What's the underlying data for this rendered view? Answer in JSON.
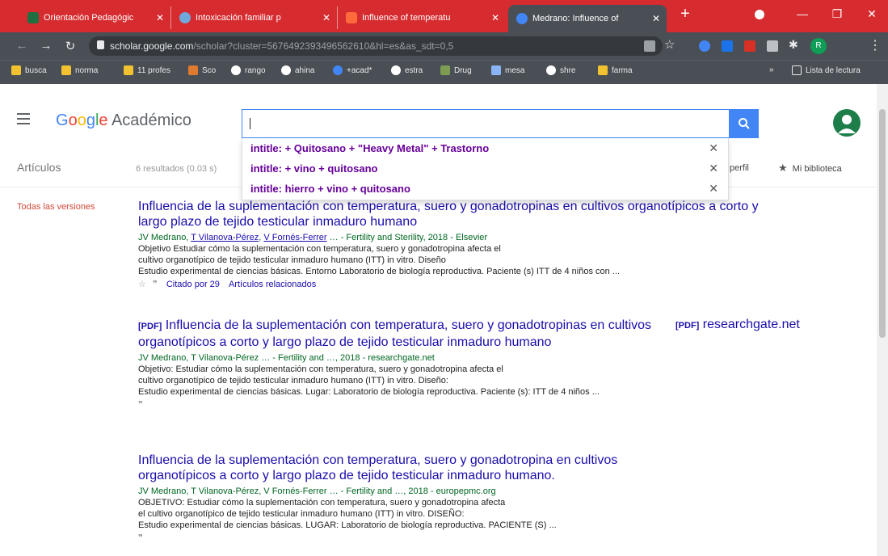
{
  "tabs": [
    {
      "title": "Orientación Pedagógic",
      "icon": "classroom-icon",
      "color": "#1f6f43"
    },
    {
      "title": "Intoxicación familiar p",
      "icon": "globe-icon",
      "color": "#6fa8dc"
    },
    {
      "title": "Influence of temperatu",
      "icon": "e-icon",
      "color": "#ff6a3d"
    },
    {
      "title": "Medrano: Influence of",
      "icon": "scholar-icon",
      "color": "#4285f4"
    }
  ],
  "url": {
    "host": "scholar.google.com",
    "path": "/scholar?cluster=5676492393496562610&hl=es&as_sdt=0,5"
  },
  "bookmarks": [
    "busca",
    "norma",
    "11 profes",
    "Sco",
    "rango",
    "ahina",
    "+acad*",
    "estra",
    "Drug",
    "mesa",
    "shre",
    "farma"
  ],
  "reading_list": "Lista de lectura",
  "header": {
    "logo_google": "Google",
    "logo_suffix": "Académico"
  },
  "search": {
    "value": ""
  },
  "suggestions": [
    "intitle: + Quitosano + \"Heavy Metal\" + Trastorno",
    "intitle: + vino + quitosano",
    "intitle: hierro + vino + quitosano"
  ],
  "subbar": {
    "articulos": "Artículos",
    "count": "6 resultados (0.03 s)",
    "perfil": "perfil",
    "mibib": "Mi biblioteca"
  },
  "sidebar": {
    "todas": "Todas las versiones"
  },
  "results": [
    {
      "tag": "",
      "title": "Influencia de la suplementación con temperatura, suero y gonadotropinas en cultivos organotípicos a corto y largo plazo de tejido testicular inmaduro humano",
      "authors_pre": "JV Medrano, ",
      "a1": "T Vilanova-Pérez",
      "a2": "V Fornés-Ferrer",
      "authors_post": " … - Fertility and Sterility, 2018 - Elsevier",
      "snippet": [
        "Objetivo Estudiar cómo la suplementación con temperatura, suero y gonadotropina afecta el",
        "cultivo organotípico de tejido testicular inmaduro humano (ITT) in vitro. Diseño",
        "Estudio experimental de ciencias básicas. Entorno Laboratorio de biología reproductiva. Paciente (s) ITT de 4 niños con ..."
      ],
      "links": [
        "Citado por 29",
        "Artículos relacionados"
      ]
    },
    {
      "tag": "[PDF]",
      "title": "Influencia de la suplementación con temperatura, suero y gonadotropinas en cultivos organotípicos a corto y largo plazo de tejido testicular inmaduro humano",
      "authors": "JV Medrano, T Vilanova-Pérez … - Fertility and …, 2018 - researchgate.net",
      "snippet": [
        "Objetivo: Estudiar cómo la suplementación con temperatura, suero y gonadotropina afecta el",
        "cultivo organotípico de tejido testicular inmaduro humano (ITT) in vitro. Diseño:",
        "Estudio experimental de ciencias básicas. Lugar: Laboratorio de biología reproductiva. Paciente (s): ITT de 4 niños ..."
      ],
      "side_tag": "[PDF]",
      "side_host": "researchgate.net"
    },
    {
      "tag": "",
      "title": "Influencia de la suplementación con temperatura, suero y gonadotropina en cultivos organotípicos a corto y largo plazo de tejido testicular inmaduro humano.",
      "authors": "JV Medrano, T Vilanova-Pérez, V Fornés-Ferrer … - Fertility and …, 2018 - europepmc.org",
      "snippet": [
        "OBJETIVO: Estudiar cómo la suplementación con temperatura, suero y gonadotropina afecta",
        "el cultivo organotípico de tejido testicular inmaduro humano (ITT) in vitro. DISEÑO:",
        "Estudio experimental de ciencias básicas. LUGAR: Laboratorio de biología reproductiva. PACIENTE (S) ..."
      ]
    }
  ]
}
